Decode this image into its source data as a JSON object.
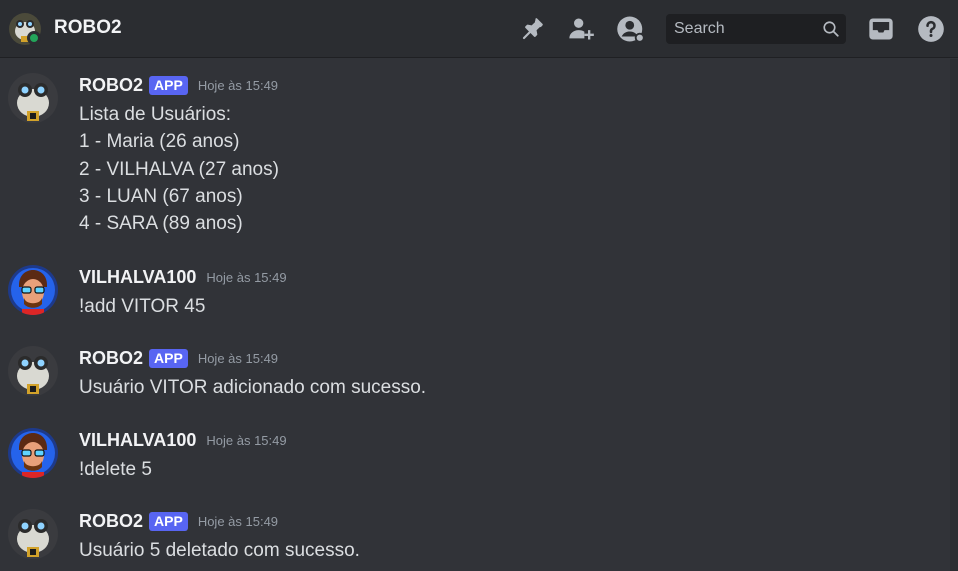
{
  "header": {
    "title": "ROBO2",
    "search_placeholder": "Search",
    "icons": [
      "pin-icon",
      "add-member-icon",
      "member-list-icon",
      "search-icon",
      "inbox-icon",
      "help-icon"
    ]
  },
  "colors": {
    "background": "#313338",
    "header": "#2b2d31",
    "badge": "#5865f2",
    "online": "#23a55a"
  },
  "messages": [
    {
      "author": "ROBO2",
      "badge": "APP",
      "timestamp": "Hoje às 15:49",
      "lines": [
        "Lista de Usuários:",
        "1 - Maria (26 anos)",
        "2 - VILHALVA (27 anos)",
        "3 - LUAN (67 anos)",
        "4 - SARA (89 anos)"
      ]
    },
    {
      "author": "VILHALVA100",
      "timestamp": "Hoje às 15:49",
      "lines": [
        "!add VITOR 45"
      ]
    },
    {
      "author": "ROBO2",
      "badge": "APP",
      "timestamp": "Hoje às 15:49",
      "lines": [
        "Usuário VITOR adicionado com sucesso."
      ]
    },
    {
      "author": "VILHALVA100",
      "timestamp": "Hoje às 15:49",
      "lines": [
        "!delete 5"
      ]
    },
    {
      "author": "ROBO2",
      "badge": "APP",
      "timestamp": "Hoje às 15:49",
      "lines": [
        "Usuário 5 deletado com sucesso."
      ]
    }
  ]
}
